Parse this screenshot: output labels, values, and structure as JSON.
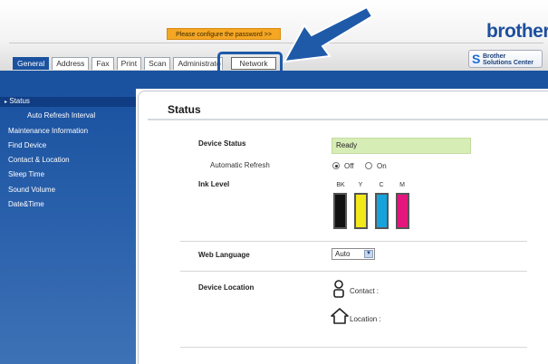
{
  "header": {
    "password_banner": "Please configure the password >>",
    "logo": "brother",
    "solutions_center_line1": "Brother",
    "solutions_center_line2": "Solutions Center",
    "tabs": [
      "General",
      "Address",
      "Fax",
      "Print",
      "Scan",
      "Administrato",
      "Network"
    ],
    "active_tab": "General",
    "highlighted_tab": "Network",
    "accent_color": "#1a52a0",
    "annotation_color": "#1e5aa8"
  },
  "sidebar": {
    "items": [
      "Status",
      "Auto Refresh Interval",
      "Maintenance Information",
      "Find Device",
      "Contact & Location",
      "Sleep Time",
      "Sound Volume",
      "Date&Time"
    ],
    "active_item": "Status",
    "active_marker": "▸"
  },
  "main": {
    "title": "Status",
    "device_status_label": "Device Status",
    "device_status_value": "Ready",
    "auto_refresh_label": "Automatic Refresh",
    "refresh_off": "Off",
    "refresh_on": "On",
    "refresh_selected": "Off",
    "ink_level_label": "Ink Level",
    "inks": [
      {
        "label": "BK",
        "color": "#111111",
        "level": 1.0
      },
      {
        "label": "Y",
        "color": "#f2e81a",
        "level": 1.0
      },
      {
        "label": "C",
        "color": "#16a3dc",
        "level": 1.0
      },
      {
        "label": "M",
        "color": "#e5157e",
        "level": 1.0
      }
    ],
    "web_language_label": "Web Language",
    "web_language_value": "Auto",
    "device_location_label": "Device Location",
    "contact_label": "Contact :",
    "location_label": "Location :"
  }
}
